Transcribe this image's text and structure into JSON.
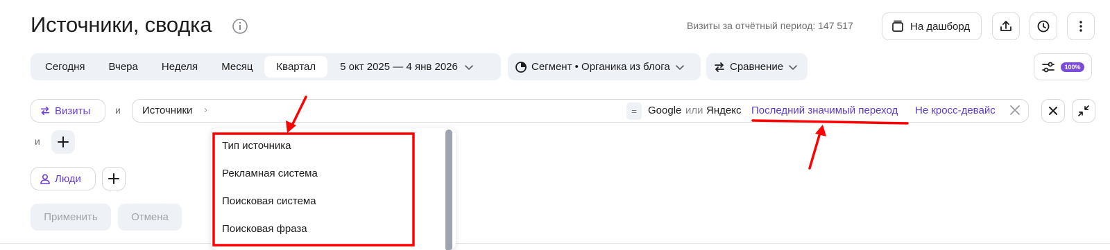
{
  "header": {
    "title": "Источники, сводка",
    "visits_text": "Визиты за отчётный период: 147 517",
    "dashboard_label": "На дашборд"
  },
  "period": {
    "tabs": [
      {
        "label": "Сегодня",
        "active": false
      },
      {
        "label": "Вчера",
        "active": false
      },
      {
        "label": "Неделя",
        "active": false
      },
      {
        "label": "Месяц",
        "active": false
      },
      {
        "label": "Квартал",
        "active": true
      }
    ],
    "date_range": "5 окт 2025 — 4 янв 2026",
    "segment_label": "Сегмент • Органика из блога",
    "compare_label": "Сравнение",
    "zoom_badge": "100%"
  },
  "filters": {
    "visits_chip": "Визиты",
    "and_1": "и",
    "source_dimension": "Источники",
    "chevron": "›",
    "eq_operator": "=",
    "value_google": "Google",
    "value_or": "или",
    "value_yandex": "Яндекс",
    "attribution": "Последний значимый переход",
    "cross_device": "Не кросс-девайс",
    "and_2": "и",
    "people_chip": "Люди"
  },
  "actions": {
    "apply": "Применить",
    "cancel": "Отмена"
  },
  "dropdown": {
    "items": [
      "Тип источника",
      "Рекламная система",
      "Поисковая система",
      "Поисковая фраза"
    ]
  },
  "colors": {
    "accent_purple": "#6b3fd1",
    "link_purple": "#5a3bc9",
    "badge_purple": "#7a4ad9",
    "annotation_red": "#ff0000",
    "pill_bg": "#eef1f5"
  },
  "icons": [
    "info-icon",
    "dashboard-icon",
    "share-icon",
    "clock-icon",
    "more-vertical-icon",
    "chevron-down-icon",
    "segment-pie-icon",
    "compare-arrows-icon",
    "sliders-icon",
    "swap-icon",
    "person-icon",
    "plus-icon",
    "close-icon",
    "collapse-icon"
  ]
}
